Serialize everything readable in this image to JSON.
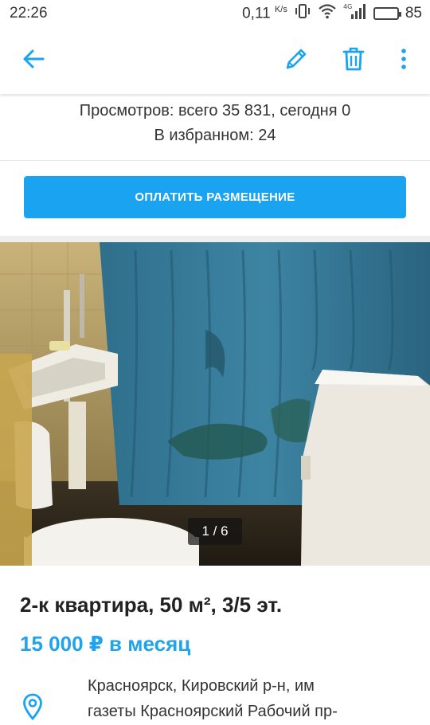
{
  "status_bar": {
    "time": "22:26",
    "network_speed": "0,11",
    "network_speed_unit": "K/s",
    "network_type": "4G",
    "battery_percent": "85",
    "battery_level": 0.85,
    "battery_color": "#f2b400"
  },
  "app_bar": {
    "icons": [
      "back-arrow-icon",
      "pencil-icon",
      "trash-icon",
      "more-vertical-icon"
    ],
    "accent_color": "#1aa3f0"
  },
  "stats": {
    "views": "Просмотров: всего 35 831, сегодня 0",
    "favorites": "В избранном: 24"
  },
  "pay_button": {
    "label": "ОПЛАТИТЬ РАЗМЕЩЕНИЕ",
    "color": "#1aa3f0"
  },
  "photo": {
    "counter": "1 / 6",
    "current": 1,
    "total": 6
  },
  "listing": {
    "title": "2-к квартира, 50 м², 3/5 эт.",
    "price": "15 000 ₽ в месяц",
    "price_color": "#1ea3ec",
    "address_line1": "Красноярск, Кировский р-н, им",
    "address_line2": "газеты Красноярский Рабочий пр-",
    "address_icon": "location-pin-icon"
  }
}
